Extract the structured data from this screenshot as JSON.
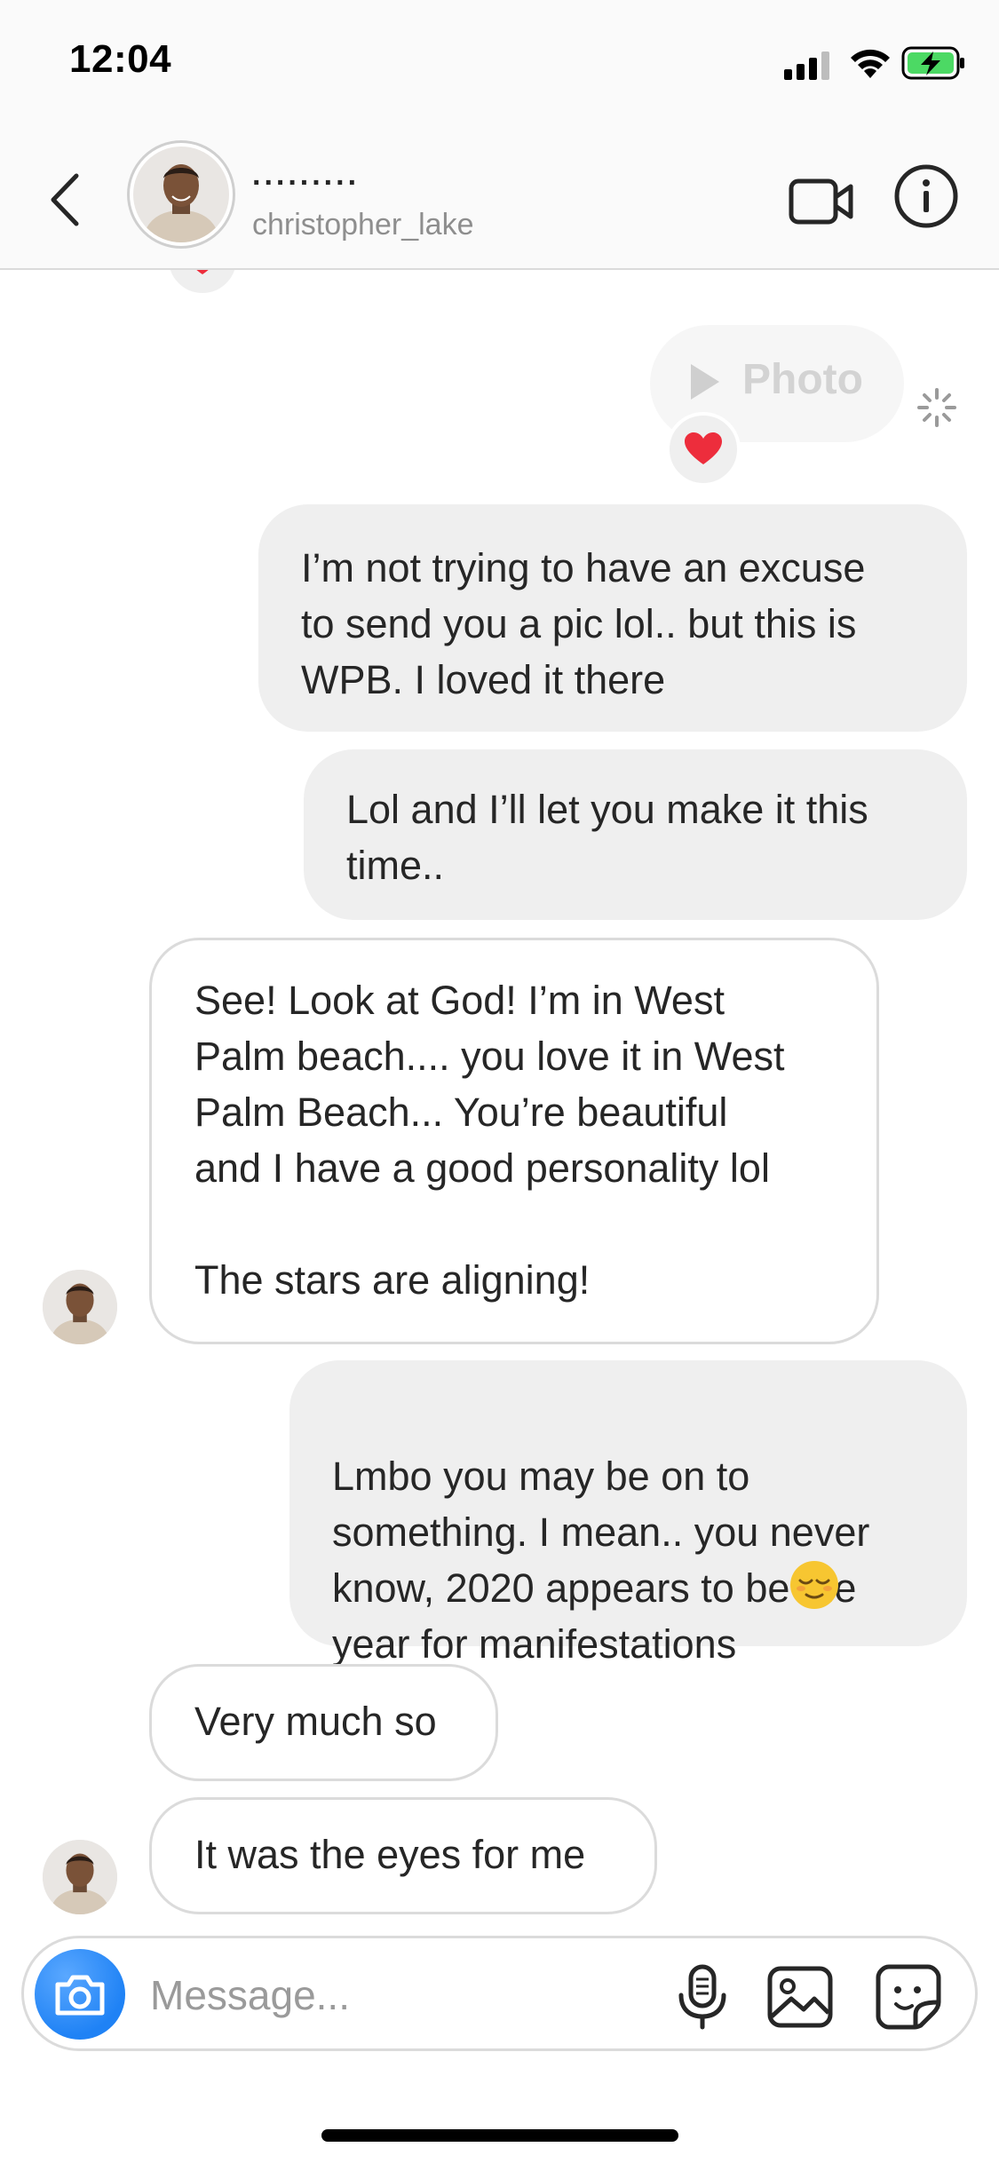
{
  "status_bar": {
    "time": "12:04",
    "icons": [
      "signal-icon",
      "wifi-icon",
      "battery-charging-icon"
    ],
    "battery_color": "#4cd964"
  },
  "header": {
    "display_name": ".........",
    "username": "christopher_lake",
    "icons": [
      "back-chevron-icon",
      "avatar",
      "video-camera-icon",
      "info-icon"
    ]
  },
  "messages": [
    {
      "id": "photo",
      "sender": "me",
      "type": "photo",
      "label": "Photo",
      "reaction": "heart-reaction-icon",
      "status_icon": "loading-spinner-icon"
    },
    {
      "id": "m1",
      "sender": "me",
      "text": "I’m not trying to have an excuse\nto send you a pic lol.. but this is\nWPB. I loved it there"
    },
    {
      "id": "m2",
      "sender": "me",
      "text": "Lol and I’ll let you make it this\ntime.."
    },
    {
      "id": "m3",
      "sender": "them",
      "text": "See! Look at God! I’m in West\nPalm beach.... you love it in West\nPalm Beach... You’re beautiful\nand I have a good personality lol\n\nThe stars are aligning!"
    },
    {
      "id": "m4",
      "sender": "me",
      "text": "Lmbo you may be on to\nsomething. I mean.. you never\nknow, 2020 appears to be the\nyear for manifestations",
      "emoji": "relieved-face-icon"
    },
    {
      "id": "m5",
      "sender": "them",
      "text": "Very much so"
    },
    {
      "id": "m6",
      "sender": "them",
      "text": "It was the eyes for me"
    }
  ],
  "composer": {
    "placeholder": "Message...",
    "value": "",
    "icons": [
      "camera-icon",
      "microphone-icon",
      "gallery-icon",
      "sticker-icon"
    ],
    "camera_color": "#1f82f5"
  },
  "colors": {
    "my_bubble": "#efefef",
    "their_bubble_border": "#dbdbdb",
    "text": "#262626",
    "secondary_text": "#8e8e8e",
    "heart": "#ed2d3c"
  }
}
